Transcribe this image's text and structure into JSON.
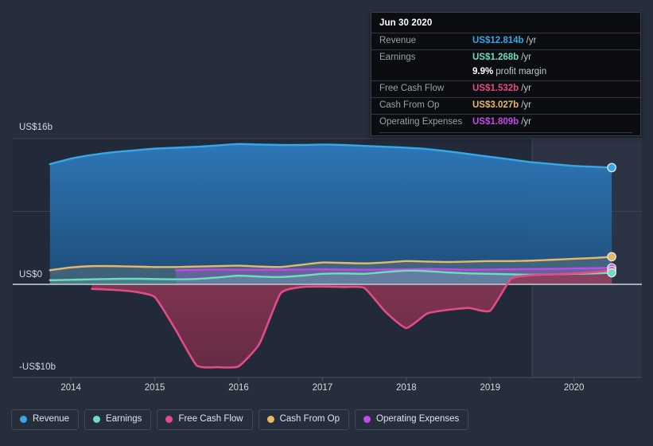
{
  "colors": {
    "background": "#272E3B",
    "revenue": "#35a8e8",
    "earnings": "#6fdcc0",
    "free_cash_flow": "#e34b87",
    "cash_from_op": "#e8b867",
    "operating_expenses": "#c14ae8",
    "gridline": "#3c4454",
    "baseline": "#b9bfc9",
    "tooltip_bg": "#0c0d11"
  },
  "tooltip": {
    "title": "Jun 30 2020",
    "rows": [
      {
        "key": "Revenue",
        "value": "US$12.814b",
        "unit": "/yr",
        "color": "#35a8e8"
      },
      {
        "key": "Earnings",
        "value": "US$1.268b",
        "unit": "/yr",
        "color": "#6fdcc0"
      },
      {
        "key": "",
        "value": "9.9%",
        "unit": "profit margin",
        "color": "#ffffff"
      },
      {
        "key": "Free Cash Flow",
        "value": "US$1.532b",
        "unit": "/yr",
        "color": "#e34b87"
      },
      {
        "key": "Cash From Op",
        "value": "US$3.027b",
        "unit": "/yr",
        "color": "#e8b867"
      },
      {
        "key": "Operating Expenses",
        "value": "US$1.809b",
        "unit": "/yr",
        "color": "#c14ae8"
      }
    ]
  },
  "legend": {
    "items": [
      {
        "label": "Revenue",
        "color": "#35a8e8"
      },
      {
        "label": "Earnings",
        "color": "#6fdcc0"
      },
      {
        "label": "Free Cash Flow",
        "color": "#e34b87"
      },
      {
        "label": "Cash From Op",
        "color": "#e8b867"
      },
      {
        "label": "Operating Expenses",
        "color": "#c14ae8"
      }
    ]
  },
  "axis": {
    "y_top_label": "US$16b",
    "y_zero_label": "US$0",
    "y_bottom_label": "-US$10b",
    "x_labels": [
      "2014",
      "2015",
      "2016",
      "2017",
      "2018",
      "2019",
      "2020"
    ]
  },
  "chart_data": {
    "type": "area",
    "title": "",
    "xlabel": "",
    "ylabel": "US$",
    "ylim": [
      -10,
      16
    ],
    "xlim": [
      2013.6,
      2020.8
    ],
    "grid": true,
    "legend_position": "bottom",
    "y_ticks": [
      16,
      8,
      0,
      -10
    ],
    "y_tick_labels": [
      "US$16b",
      "",
      "US$0",
      "-US$10b"
    ],
    "x_ticks": [
      2014,
      2015,
      2016,
      2017,
      2018,
      2019,
      2020
    ],
    "annotations": [
      {
        "type": "forecast-divider",
        "x": 2019.5
      },
      {
        "type": "endpoint-marker",
        "series": "Revenue",
        "x": 2020.45,
        "y": 12.814
      },
      {
        "type": "endpoint-marker",
        "series": "Cash From Op",
        "x": 2020.45,
        "y": 3.027
      },
      {
        "type": "endpoint-marker",
        "series": "Operating Expenses",
        "x": 2020.45,
        "y": 1.809
      },
      {
        "type": "endpoint-marker",
        "series": "Free Cash Flow",
        "x": 2020.45,
        "y": 1.532
      },
      {
        "type": "endpoint-marker",
        "series": "Earnings",
        "x": 2020.45,
        "y": 1.268
      }
    ],
    "x": [
      2013.75,
      2014.0,
      2014.25,
      2014.5,
      2014.75,
      2015.0,
      2015.25,
      2015.5,
      2015.75,
      2016.0,
      2016.25,
      2016.5,
      2016.75,
      2017.0,
      2017.25,
      2017.5,
      2017.75,
      2018.0,
      2018.25,
      2018.5,
      2018.75,
      2019.0,
      2019.25,
      2019.5,
      2019.75,
      2020.0,
      2020.25,
      2020.45
    ],
    "series": [
      {
        "name": "Revenue",
        "color": "#35a8e8",
        "values": [
          13.2,
          13.8,
          14.2,
          14.5,
          14.7,
          14.9,
          15.0,
          15.1,
          15.25,
          15.4,
          15.35,
          15.3,
          15.3,
          15.35,
          15.3,
          15.2,
          15.1,
          15.0,
          14.85,
          14.6,
          14.3,
          14.0,
          13.7,
          13.4,
          13.2,
          13.0,
          12.9,
          12.814
        ]
      },
      {
        "name": "Earnings",
        "color": "#6fdcc0",
        "values": [
          0.45,
          0.5,
          0.55,
          0.6,
          0.62,
          0.58,
          0.55,
          0.6,
          0.75,
          0.95,
          0.85,
          0.8,
          0.95,
          1.15,
          1.2,
          1.15,
          1.35,
          1.5,
          1.45,
          1.3,
          1.2,
          1.15,
          1.1,
          1.05,
          1.1,
          1.15,
          1.2,
          1.268
        ]
      },
      {
        "name": "Free Cash Flow",
        "color": "#e34b87",
        "values": [
          null,
          null,
          -0.5,
          -0.6,
          -0.8,
          -1.4,
          -5.0,
          -8.9,
          -9.1,
          -9.0,
          -6.5,
          -1.0,
          -0.3,
          -0.25,
          -0.3,
          -0.4,
          -3.0,
          -4.8,
          -3.2,
          -2.8,
          -2.6,
          -2.9,
          0.6,
          1.0,
          1.1,
          1.2,
          1.35,
          1.532
        ]
      },
      {
        "name": "Cash From Op",
        "color": "#e8b867",
        "values": [
          1.55,
          1.85,
          2.0,
          2.0,
          1.95,
          1.9,
          1.9,
          1.95,
          2.0,
          2.05,
          1.95,
          1.9,
          2.15,
          2.4,
          2.35,
          2.3,
          2.4,
          2.55,
          2.5,
          2.45,
          2.5,
          2.55,
          2.55,
          2.6,
          2.7,
          2.8,
          2.9,
          3.027
        ]
      },
      {
        "name": "Operating Expenses",
        "color": "#c14ae8",
        "values": [
          null,
          null,
          null,
          null,
          null,
          null,
          1.55,
          1.6,
          1.62,
          1.6,
          1.6,
          1.6,
          1.62,
          1.65,
          1.62,
          1.6,
          1.62,
          1.65,
          1.68,
          1.65,
          1.6,
          1.62,
          1.65,
          1.68,
          1.7,
          1.75,
          1.78,
          1.809
        ]
      }
    ]
  }
}
